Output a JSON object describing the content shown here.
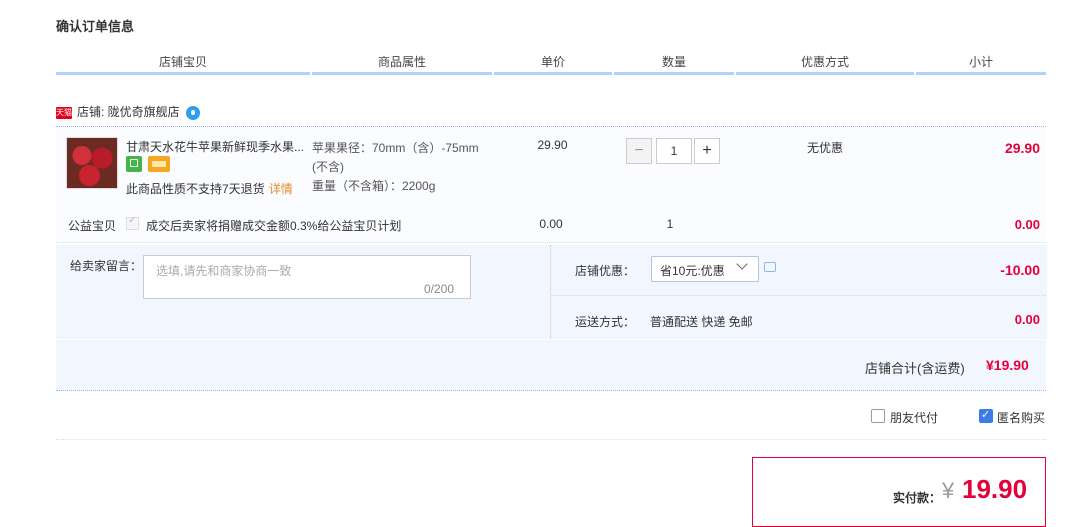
{
  "page": {
    "title": "确认订单信息"
  },
  "columns": [
    "店铺宝贝",
    "商品属性",
    "单价",
    "数量",
    "优惠方式",
    "小计"
  ],
  "shop": {
    "tag": "天猫",
    "label": "店铺: 陇优奇旗舰店"
  },
  "item": {
    "name": "甘肃天水花牛苹果新鲜现季水果...",
    "attr_line1": "苹果果径：70mm（含）-75mm",
    "attr_line2": "(不含)",
    "attr_line3": "重量（不含箱）：2200g",
    "no_return": "此商品性质不支持7天退货",
    "detail_link": "详情",
    "price": "29.90",
    "quantity": "1",
    "qty_minus": "−",
    "qty_plus": "+",
    "promotion": "无优惠",
    "subtotal": "29.90"
  },
  "charity": {
    "label": "公益宝贝",
    "text": "成交后卖家将捐赠成交金额0.3%给公益宝贝计划",
    "price": "0.00",
    "quantity": "1",
    "subtotal": "0.00"
  },
  "message": {
    "label": "给卖家留言：",
    "placeholder": "选填,请先和商家协商一致",
    "counter": "0/200"
  },
  "shop_discount": {
    "label": "店铺优惠：",
    "selected": "省10元:优惠",
    "amount": "-10.00"
  },
  "shipping": {
    "label": "运送方式：",
    "value": "普通配送 快递 免邮",
    "amount": "0.00"
  },
  "shop_total": {
    "label": "店铺合计(含运费)",
    "amount": "¥19.90"
  },
  "options": {
    "friend_pay": "朋友代付",
    "friend_checked": false,
    "anonymous": "匿名购买",
    "anonymous_checked": true
  },
  "payment": {
    "label": "实付款：",
    "currency": "¥",
    "amount": "19.90"
  },
  "colors": {
    "accent_red": "#e4003a",
    "checkbox_blue": "#3c7bea",
    "header_underline": "#b2d1ff",
    "row_bg": "#f2f7ff"
  }
}
